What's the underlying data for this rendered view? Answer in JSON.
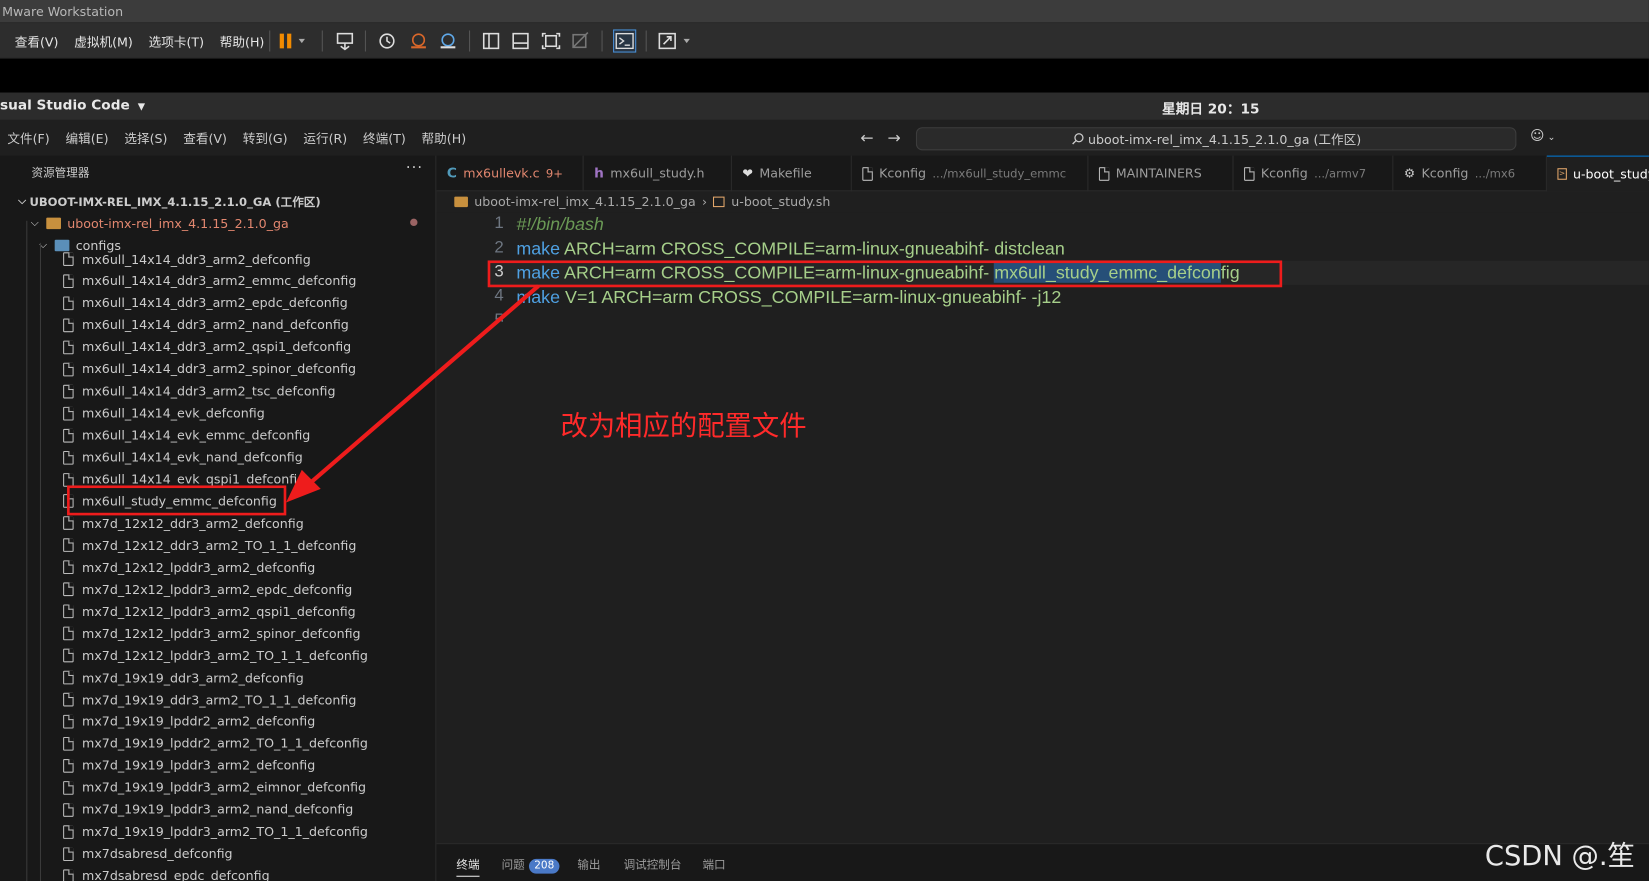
{
  "vmware": {
    "title": "Mware Workstation",
    "menu": [
      "查看(V)",
      "虚拟机(M)",
      "选项卡(T)",
      "帮助(H)"
    ]
  },
  "ubuntu": {
    "app_name": "sual Studio Code",
    "clock": "星期日 20：15"
  },
  "vscode": {
    "menu": [
      "文件(F)",
      "编辑(E)",
      "选择(S)",
      "查看(V)",
      "转到(G)",
      "运行(R)",
      "终端(T)",
      "帮助(H)"
    ],
    "command_center": "uboot-imx-rel_imx_4.1.15_2.1.0_ga (工作区)",
    "explorer_title": "资源管理器",
    "workspace_name": "UBOOT-IMX-REL_IMX_4.1.15_2.1.0_GA (工作区)",
    "root_folder": "uboot-imx-rel_imx_4.1.15_2.1.0_ga",
    "configs_folder": "configs",
    "files": [
      "mx6ull_14x14_ddr3_arm2_defconfig",
      "mx6ull_14x14_ddr3_arm2_emmc_defconfig",
      "mx6ull_14x14_ddr3_arm2_epdc_defconfig",
      "mx6ull_14x14_ddr3_arm2_nand_defconfig",
      "mx6ull_14x14_ddr3_arm2_qspi1_defconfig",
      "mx6ull_14x14_ddr3_arm2_spinor_defconfig",
      "mx6ull_14x14_ddr3_arm2_tsc_defconfig",
      "mx6ull_14x14_evk_defconfig",
      "mx6ull_14x14_evk_emmc_defconfig",
      "mx6ull_14x14_evk_nand_defconfig",
      "mx6ull_14x14_evk_qspi1_defconfig",
      "mx6ull_study_emmc_defconfig",
      "mx7d_12x12_ddr3_arm2_defconfig",
      "mx7d_12x12_ddr3_arm2_TO_1_1_defconfig",
      "mx7d_12x12_lpddr3_arm2_defconfig",
      "mx7d_12x12_lpddr3_arm2_epdc_defconfig",
      "mx7d_12x12_lpddr3_arm2_qspi1_defconfig",
      "mx7d_12x12_lpddr3_arm2_spinor_defconfig",
      "mx7d_12x12_lpddr3_arm2_TO_1_1_defconfig",
      "mx7d_19x19_ddr3_arm2_defconfig",
      "mx7d_19x19_ddr3_arm2_TO_1_1_defconfig",
      "mx7d_19x19_lpddr2_arm2_defconfig",
      "mx7d_19x19_lpddr2_arm2_TO_1_1_defconfig",
      "mx7d_19x19_lpddr3_arm2_defconfig",
      "mx7d_19x19_lpddr3_arm2_eimnor_defconfig",
      "mx7d_19x19_lpddr3_arm2_nand_defconfig",
      "mx7d_19x19_lpddr3_arm2_TO_1_1_defconfig",
      "mx7dsabresd_defconfig",
      "mx7dsabresd_epdc_defconfig"
    ],
    "tabs": [
      {
        "label": "mx6ullevk.c",
        "badge": "9+",
        "icon": "C",
        "icon_color": "#519aba"
      },
      {
        "label": "mx6ull_study.h",
        "icon": "h",
        "icon_color": "#a074c4"
      },
      {
        "label": "Makefile",
        "icon": "❤",
        "icon_color": "#e37933"
      },
      {
        "label": "Kconfig",
        "desc": ".../mx6ull_study_emmc",
        "icon": "file"
      },
      {
        "label": "MAINTAINERS",
        "icon": "file"
      },
      {
        "label": "Kconfig",
        "desc": ".../armv7",
        "icon": "file"
      },
      {
        "label": "Kconfig",
        "desc": ".../mx6",
        "icon": "gear"
      },
      {
        "label": "u-boot_study.sh",
        "icon": "term"
      }
    ],
    "breadcrumb": [
      "uboot-imx-rel_imx_4.1.15_2.1.0_ga",
      "u-boot_study.sh"
    ],
    "code_lines": [
      {
        "num": "1",
        "kw": "",
        "rest": "#!/bin/bash",
        "sel": "",
        "tail": ""
      },
      {
        "num": "2",
        "kw": "make",
        "rest": " ARCH=arm CROSS_COMPILE=arm-linux-gnueabihf- distclean",
        "sel": "",
        "tail": ""
      },
      {
        "num": "3",
        "kw": "make",
        "rest": " ARCH=arm CROSS_COMPILE=arm-linux-gnueabihf- ",
        "sel": "mx6ull_study_emmc_defcon",
        "tail": "fig"
      },
      {
        "num": "4",
        "kw": "make",
        "rest": " V=1 ARCH=arm CROSS_COMPILE=arm-linux-gnueabihf- -j12",
        "sel": "",
        "tail": ""
      },
      {
        "num": "5",
        "kw": "",
        "rest": "",
        "sel": "",
        "tail": ""
      }
    ],
    "annotation": "改为相应的配置文件",
    "panel_tabs": [
      "终端",
      "问题",
      "输出",
      "调试控制台",
      "端口"
    ],
    "problems_count": "208",
    "watermark": "CSDN @.笙"
  },
  "colors": {
    "accent": "#0078d4",
    "annotation_red": "#ff2a2a",
    "vmware_pause": "#f28b00"
  }
}
